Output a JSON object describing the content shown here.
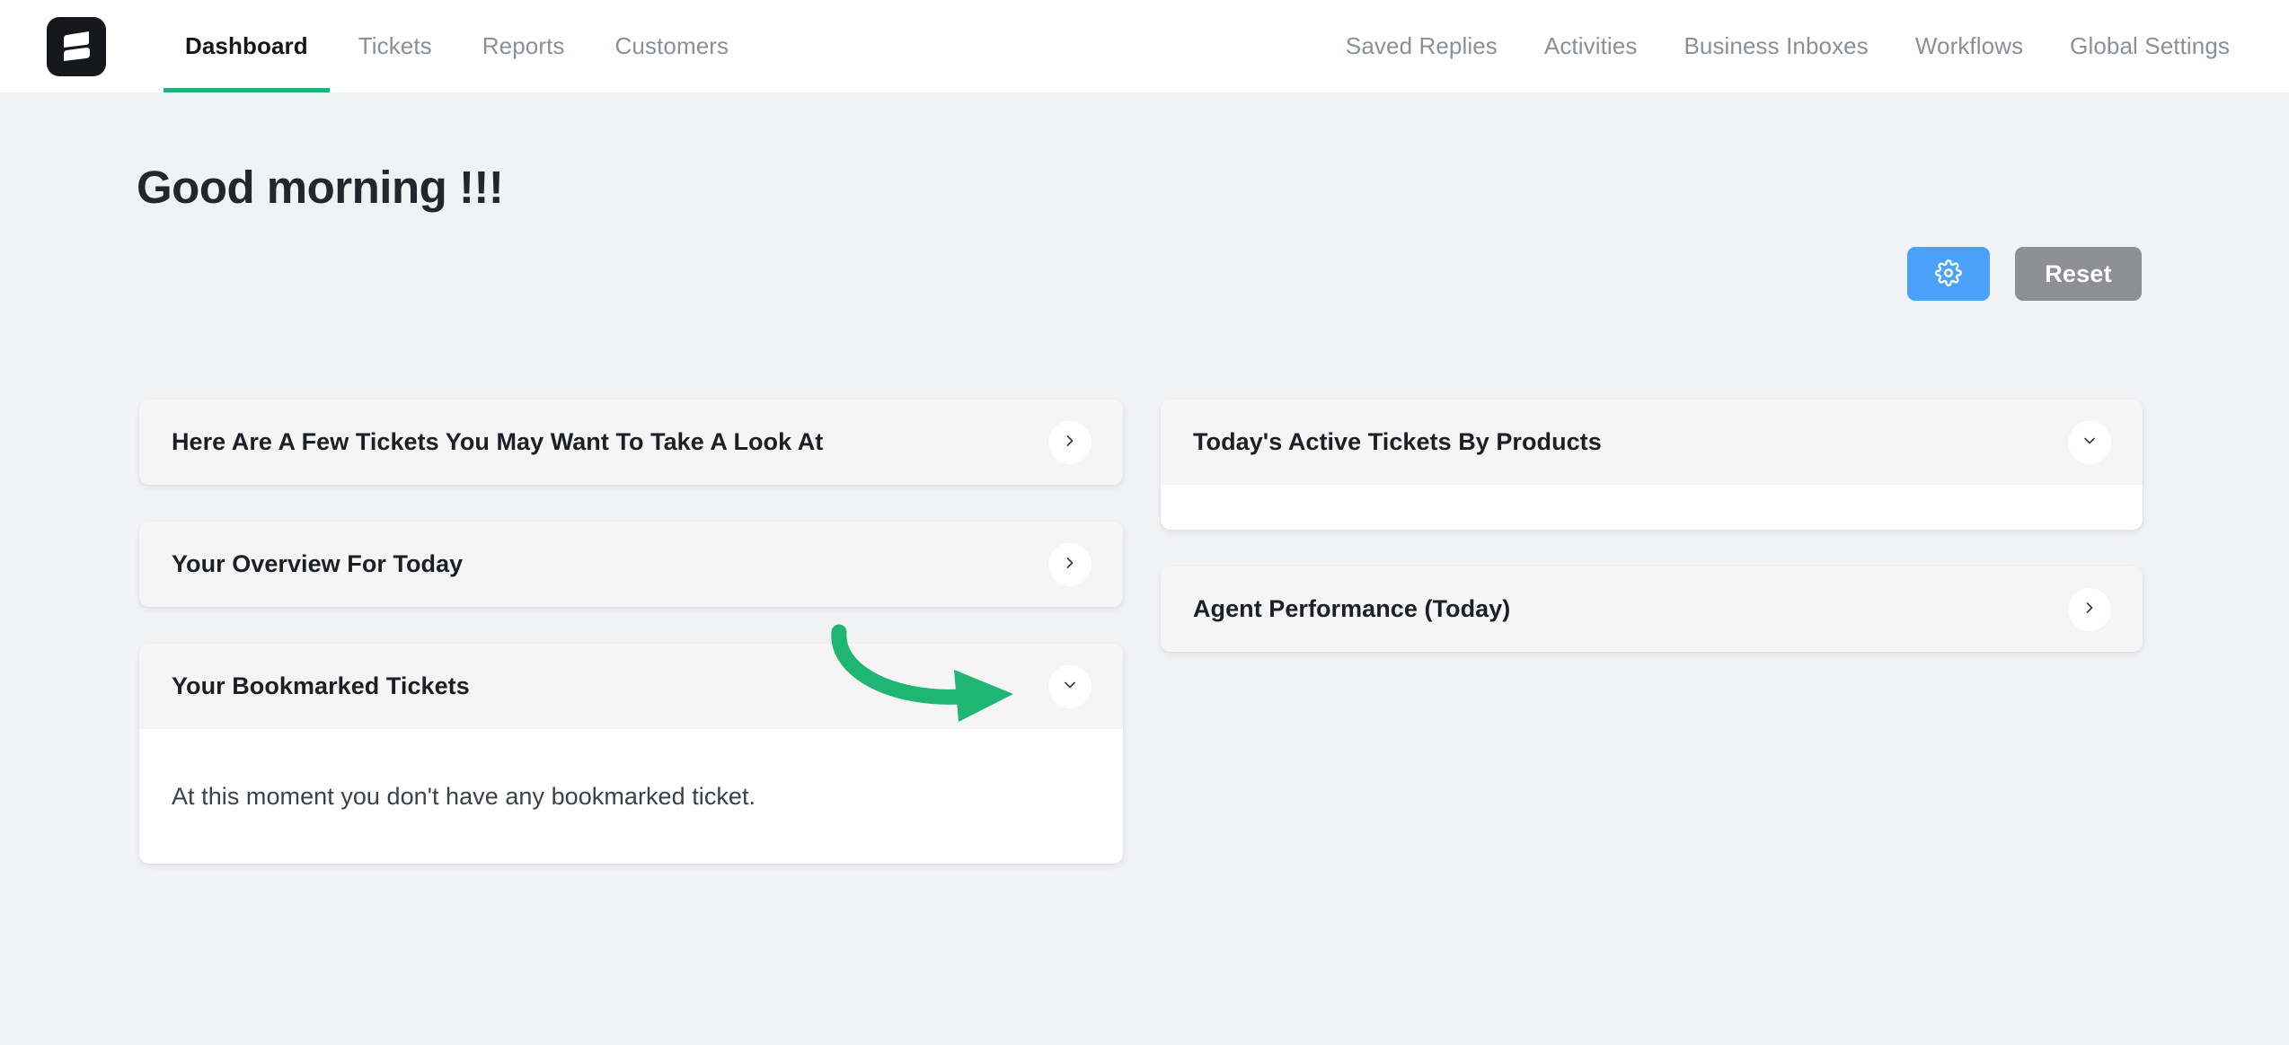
{
  "nav": {
    "logo_icon": "thrive-desk-logo-icon",
    "left_items": [
      {
        "label": "Dashboard",
        "active": true
      },
      {
        "label": "Tickets",
        "active": false
      },
      {
        "label": "Reports",
        "active": false
      },
      {
        "label": "Customers",
        "active": false
      }
    ],
    "right_items": [
      {
        "label": "Saved Replies"
      },
      {
        "label": "Activities"
      },
      {
        "label": "Business Inboxes"
      },
      {
        "label": "Workflows"
      },
      {
        "label": "Global Settings"
      }
    ],
    "active_underline_color": "#22b07d"
  },
  "header": {
    "greeting": "Good morning !!!",
    "settings_button": {
      "icon": "gear-icon",
      "color": "#4aa3f8"
    },
    "reset_button": {
      "label": "Reset",
      "color": "#8e8f93"
    }
  },
  "cards": {
    "left": [
      {
        "title": "Here Are A Few Tickets You May Want To Take A Look At",
        "toggle_icon": "chevron-right-icon",
        "expanded": false
      },
      {
        "title": "Your Overview For Today",
        "toggle_icon": "chevron-right-icon",
        "expanded": false
      },
      {
        "title": "Your Bookmarked Tickets",
        "toggle_icon": "chevron-down-icon",
        "expanded": true,
        "body_text": "At this moment you don't have any bookmarked ticket."
      }
    ],
    "right": [
      {
        "title": "Today's Active Tickets By Products",
        "toggle_icon": "chevron-down-icon",
        "expanded": true,
        "body_text": ""
      },
      {
        "title": "Agent Performance (Today)",
        "toggle_icon": "chevron-right-icon",
        "expanded": false
      }
    ]
  },
  "annotation": {
    "type": "curved-arrow",
    "color": "#1fb573",
    "points_to": "Your Bookmarked Tickets collapse toggle"
  }
}
